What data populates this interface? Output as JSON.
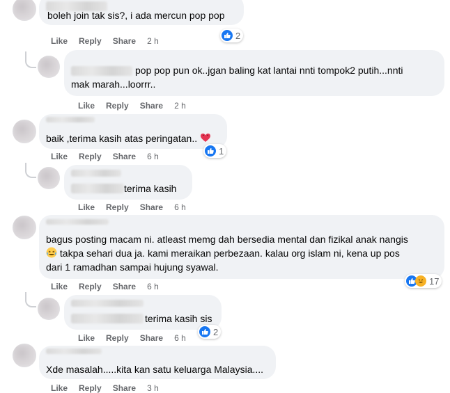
{
  "comments": [
    {
      "id": "c1",
      "text": "boleh join tak sis?, i ada mercun pop pop",
      "time": "2 h",
      "reaction_count": "2"
    },
    {
      "id": "c2",
      "text_line1": "pop pop pun ok..jgan baling kat lantai nnti tompok2 putih...nnti",
      "text_line2": "mak marah...loorrr..",
      "time": "2 h"
    },
    {
      "id": "c3",
      "text": "baik ,terima kasih atas peringatan..",
      "time": "6 h",
      "reaction_count": "1"
    },
    {
      "id": "c4",
      "text": "terima kasih",
      "time": "6 h"
    },
    {
      "id": "c5",
      "text_line1": "bagus posting macam ni. atleast memg dah bersedia mental dan fizikal anak nangis",
      "text_line2": "takpa sehari dua ja. kami meraikan perbezaan. kalau org islam ni, kena up pos",
      "text_line3": "dari 1 ramadhan sampai hujung syawal.",
      "time": "6 h",
      "reaction_count": "17"
    },
    {
      "id": "c6",
      "text": "terima kasih sis",
      "time": "6 h",
      "reaction_count": "2"
    },
    {
      "id": "c7",
      "text": "Xde masalah.....kita kan satu keluarga Malaysia....",
      "time": "3 h"
    }
  ],
  "actions": {
    "like": "Like",
    "reply": "Reply",
    "share": "Share"
  },
  "colors": {
    "bubble": "#f0f2f5",
    "action": "#65676b",
    "like": "#1877f2",
    "love": "#f33e58",
    "haha": "#f7b125"
  }
}
